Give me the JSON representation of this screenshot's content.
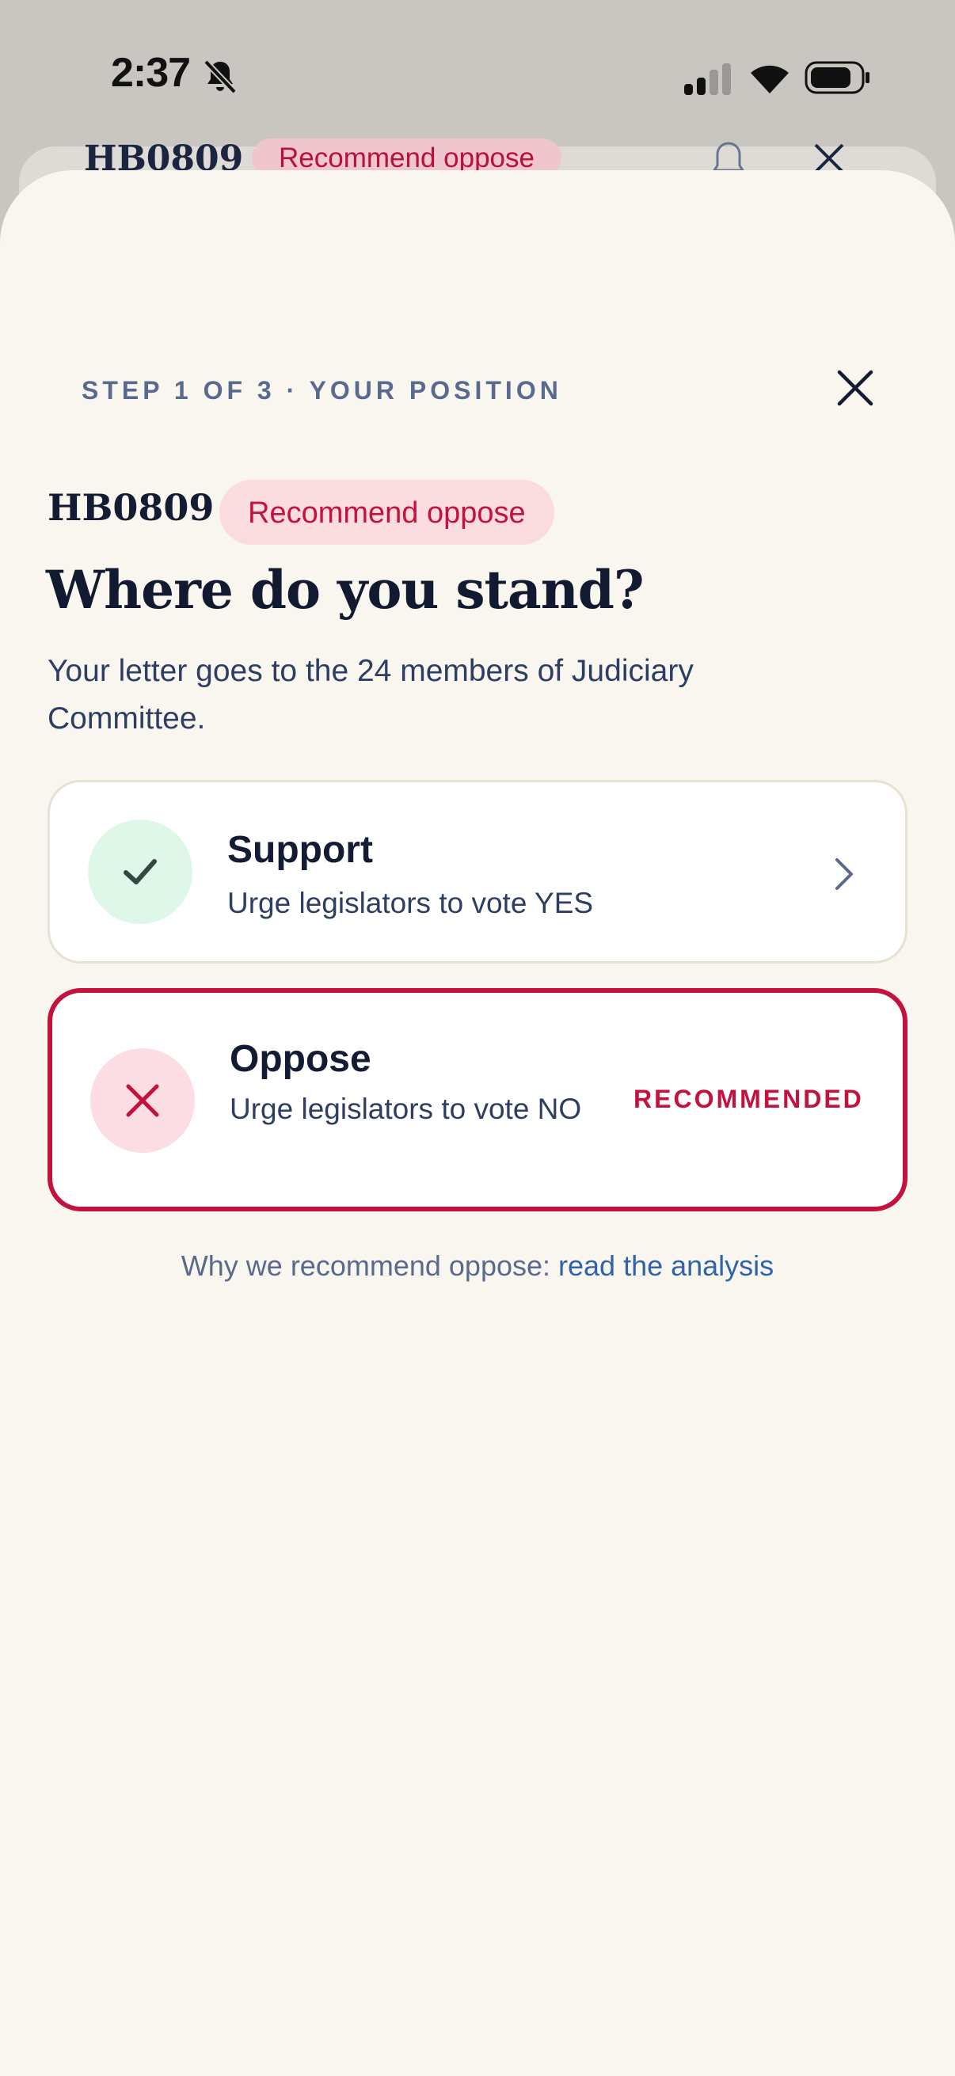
{
  "status_bar": {
    "time": "2:37",
    "icons": [
      "bell-slash-icon",
      "cellular-signal-icon",
      "wifi-icon",
      "battery-icon"
    ]
  },
  "background_page": {
    "bill_id": "HB0809",
    "recommendation": "Recommend oppose",
    "icons": [
      "bell-icon",
      "close-icon"
    ]
  },
  "sheet": {
    "step_label": "STEP 1 OF 3 · YOUR POSITION",
    "bill_id": "HB0809",
    "recommendation_badge": "Recommend oppose",
    "headline": "Where do you stand?",
    "subtitle": "Your letter goes to the 24 members of Judiciary Committee.",
    "options": [
      {
        "title": "Support",
        "description": "Urge legislators to vote YES",
        "icon": "check-icon",
        "trailing_icon": "chevron-right-icon"
      },
      {
        "title": "Oppose",
        "description": "Urge legislators to vote NO",
        "icon": "x-icon",
        "tag": "RECOMMENDED"
      }
    ],
    "footnote": {
      "text": "Why we recommend oppose: ",
      "link": "read the analysis"
    }
  },
  "colors": {
    "accent_red": "#c4123f",
    "support_green_bg": "#dff7e8",
    "oppose_red_bg": "#fbdde3",
    "sheet_bg": "#f9f6f0",
    "link_blue": "#2f64a8"
  }
}
